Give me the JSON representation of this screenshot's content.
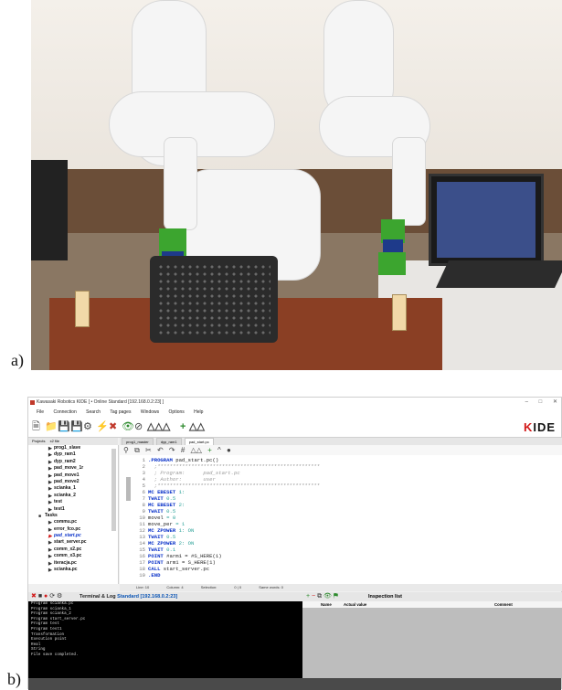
{
  "labels": {
    "a": "a)",
    "b": "b)"
  },
  "ide": {
    "window_title": "Kawasaki Robotics KIDE [ • Online Standard [192.168.0.2:23] ]",
    "window_buttons": [
      "–",
      "□",
      "✕"
    ],
    "menu": [
      "File",
      "Connection",
      "Search",
      "Tag pages",
      "Windows",
      "Options",
      "Help"
    ],
    "logo_k": "K",
    "logo_text": "IDE",
    "projects_tab": "Projects",
    "project_name": "x2 file",
    "tree": [
      {
        "label": "prog1_slave",
        "type": "file"
      },
      {
        "label": "dyp_ram1",
        "type": "file"
      },
      {
        "label": "dyp_ram2",
        "type": "file"
      },
      {
        "label": "pad_move_1r",
        "type": "file"
      },
      {
        "label": "pad_move1",
        "type": "file"
      },
      {
        "label": "pad_move2",
        "type": "file"
      },
      {
        "label": "scianka_1",
        "type": "file"
      },
      {
        "label": "scianka_2",
        "type": "file"
      },
      {
        "label": "test",
        "type": "file"
      },
      {
        "label": "test1",
        "type": "file"
      },
      {
        "label": "Tasks",
        "type": "folder"
      },
      {
        "label": "commu.pc",
        "type": "file"
      },
      {
        "label": "error_fco.pc",
        "type": "file"
      },
      {
        "label": "pad_start.pc",
        "type": "active"
      },
      {
        "label": "start_server.pc",
        "type": "file"
      },
      {
        "label": "comm_x2.pc",
        "type": "file"
      },
      {
        "label": "comm_x3.pc",
        "type": "file"
      },
      {
        "label": "iteracja.pc",
        "type": "file"
      },
      {
        "label": "scianka.pc",
        "type": "file"
      }
    ],
    "editor_tabs": [
      "prog1_master",
      "dyp_ram1",
      "pad_start.pc"
    ],
    "code": {
      "l1": {
        "n": "1",
        "a": ".PROGRAM",
        "b": " pad_start.pc()"
      },
      "l2": {
        "n": "2",
        "t": "  ;*****************************************************"
      },
      "l3": {
        "n": "3",
        "t": "  ; Program:      pad_start.pc"
      },
      "l4": {
        "n": "4",
        "t": "  ; Author:       user"
      },
      "l5": {
        "n": "5",
        "t": "  ;*****************************************************"
      },
      "l6": {
        "n": "6",
        "a": "MC EBESET",
        "b": " 1:"
      },
      "l7": {
        "n": "7",
        "a": "TWAIT",
        "b": " 0.5"
      },
      "l8": {
        "n": "8",
        "a": "MC EBESET",
        "b": " 2:"
      },
      "l9": {
        "n": "9",
        "a": "TWAIT",
        "b": " 0.5"
      },
      "l10": {
        "n": "10",
        "a": "movel",
        "b": " = 0"
      },
      "l11": {
        "n": "11",
        "a": "move_per",
        "b": " = 1"
      },
      "l12": {
        "n": "12",
        "a": "MC ZPOWER",
        "b": " 1: ON"
      },
      "l13": {
        "n": "13",
        "a": "TWAIT",
        "b": " 0.5"
      },
      "l14": {
        "n": "14",
        "a": "MC ZPOWER",
        "b": " 2: ON"
      },
      "l15": {
        "n": "15",
        "a": "TWAIT",
        "b": " 0.1"
      },
      "l16": {
        "n": "16",
        "a": "POINT",
        "b": " #arm1 = #S_HERE(1)"
      },
      "l17": {
        "n": "17",
        "a": "POINT",
        "b": " arm1 = S_HERE(1)"
      },
      "l18": {
        "n": "18",
        "a": "CALL",
        "b": " start_server.pc"
      },
      "l19": {
        "n": "19",
        "a": ".END",
        "b": ""
      }
    },
    "status_bar": [
      "Line: 10",
      "Column: 4",
      "Selection:",
      "0 | 0",
      "Same words: 0"
    ],
    "terminal": {
      "title": "Terminal & Log",
      "connection": "Standard [192.168.0.2:23]",
      "lines": [
        "Program scianka.pc",
        "Program scianka_1",
        "Program scianka_2",
        "Program start_server.pc",
        "Program test",
        "Program test1",
        "Transformation",
        "Execution point",
        "Real",
        "String",
        "File save completed."
      ]
    },
    "inspection": {
      "title": "Inspection list",
      "columns": [
        "Name",
        "Actual value",
        "Comment"
      ]
    }
  }
}
